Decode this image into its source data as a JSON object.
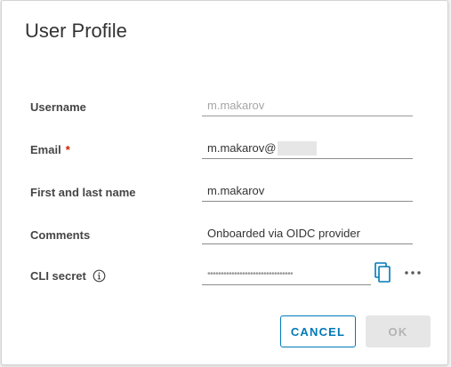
{
  "dialog": {
    "title": "User Profile"
  },
  "form": {
    "username": {
      "label": "Username",
      "value": "m.makarov"
    },
    "email": {
      "label": "Email",
      "required_mark": "*",
      "value": "m.makarov@"
    },
    "full_name": {
      "label": "First and last name",
      "value": "m.makarov"
    },
    "comments": {
      "label": "Comments",
      "value": "Onboarded via OIDC provider"
    },
    "cli_secret": {
      "label": "CLI secret",
      "value": "••••••••••••••••••••••••••••••••"
    }
  },
  "buttons": {
    "cancel": "CANCEL",
    "ok": "OK"
  },
  "colors": {
    "accent": "#0079b8",
    "required": "#c92100",
    "disabled_bg": "#e6e6e6"
  },
  "icons": {
    "info": "info-icon",
    "copy": "copy-icon",
    "more": "ellipsis-icon"
  }
}
